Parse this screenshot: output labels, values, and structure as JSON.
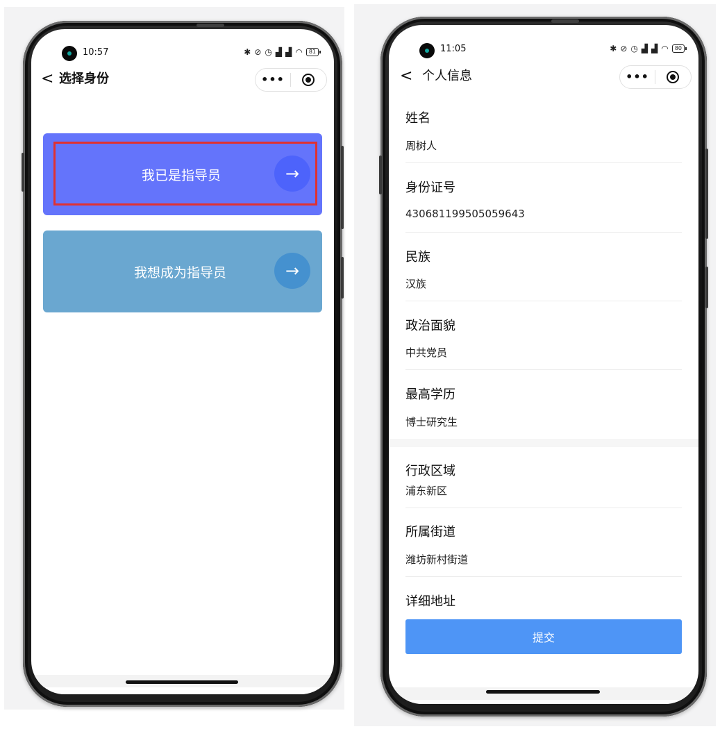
{
  "left_screen": {
    "status": {
      "time": "10:57",
      "battery": "81",
      "icons": [
        "bluetooth-icon",
        "mute-icon",
        "alarm-icon",
        "signal-hd-icon",
        "signal-hd-icon",
        "wifi-icon"
      ]
    },
    "nav": {
      "back": "<",
      "title": "选择身份",
      "more": "•••"
    },
    "cards": [
      {
        "label": "我已是指导员",
        "arrow": "→",
        "color": "#6474fb",
        "arrow_bg": "#4d63fb"
      },
      {
        "label": "我想成为指导员",
        "arrow": "→",
        "color": "#6aa7d0",
        "arrow_bg": "#4591cf"
      }
    ]
  },
  "right_screen": {
    "status": {
      "time": "11:05",
      "battery": "80",
      "icons": [
        "bluetooth-icon",
        "mute-icon",
        "alarm-icon",
        "signal-hd-icon",
        "signal-hd-icon",
        "wifi-icon"
      ]
    },
    "nav": {
      "back": "<",
      "title": "个人信息",
      "more": "•••"
    },
    "fields": [
      {
        "label": "姓名",
        "value": "周树人"
      },
      {
        "label": "身份证号",
        "value": "430681199505059643"
      },
      {
        "label": "民族",
        "value": "汉族"
      },
      {
        "label": "政治面貌",
        "value": "中共党员"
      },
      {
        "label": "最高学历",
        "value": "博士研究生"
      }
    ],
    "address_fields": [
      {
        "label": "行政区域",
        "value": "浦东新区"
      },
      {
        "label": "所属街道",
        "value": "潍坊新村街道"
      },
      {
        "label": "详细地址",
        "value": ""
      }
    ],
    "submit_label": "提交",
    "submit_color": "#4e95f6"
  }
}
